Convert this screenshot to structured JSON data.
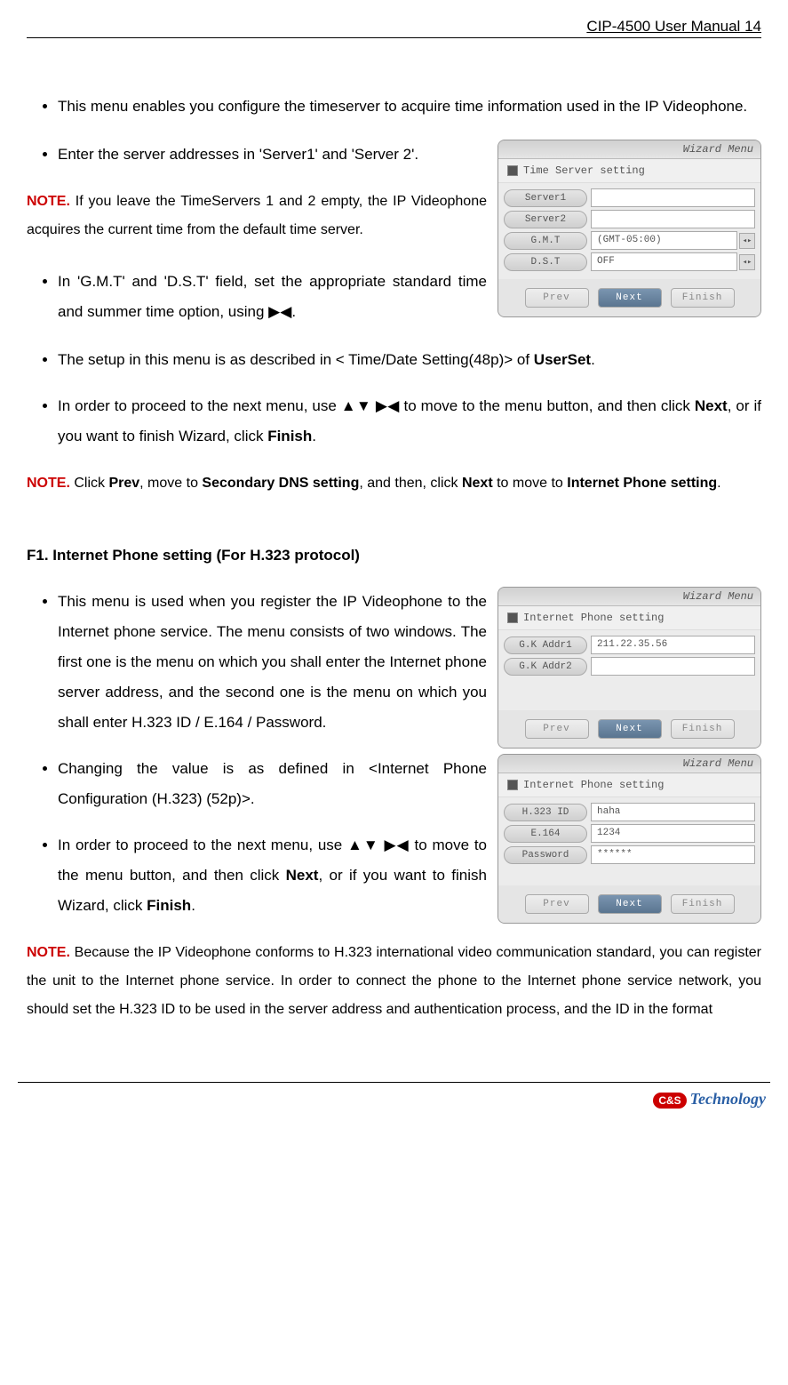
{
  "header": {
    "manual": "CIP-4500 User Manual",
    "page": "14"
  },
  "bullets1": [
    "This menu enables you configure the timeserver to acquire time information used in the IP Videophone.",
    "Enter the server addresses in 'Server1' and 'Server 2'."
  ],
  "note1": {
    "label": "NOTE.",
    "text": " If you leave the TimeServers 1 and 2 empty, the IP Videophone acquires the current time from the default time server."
  },
  "bullets2": [
    "In 'G.M.T' and 'D.S.T' field, set the appropriate standard time and summer time option, using ▶◀.",
    "The setup in this menu is as described in < Time/Date Setting(48p)> of ",
    "In order to proceed to the next menu, use ▲▼ ▶◀ to move to the menu button, and then click "
  ],
  "bullets2_bold": {
    "userset": "UserSet",
    "next": "Next",
    "finish": "Finish",
    "tail": ", or if you want to finish Wizard, click "
  },
  "note2": {
    "label": "NOTE.",
    "parts": {
      "p1": " Click ",
      "p2": "Prev",
      "p3": ", move to ",
      "p4": "Secondary DNS setting",
      "p5": ", and then, click ",
      "p6": "Next",
      "p7": " to move to ",
      "p8": "Internet Phone setting",
      "p9": "."
    }
  },
  "sectionF1": {
    "title": "F1. Internet Phone setting (For H.323 protocol)"
  },
  "bulletsF1": [
    "This menu is used when you register the IP Videophone to the Internet phone service. The menu consists of two windows. The first one is the menu on which you shall enter the Internet phone server address, and the second one is the menu on which you shall enter H.323 ID / E.164 / Password.",
    "Changing the value is as defined in <Internet Phone Configuration (H.323) (52p)>.",
    "In order to proceed to the next menu, use ▲▼ ▶◀ to move to the menu button, and then click "
  ],
  "bulletsF1_bold": {
    "next": "Next",
    "mid": ", or if you want to finish Wizard, click ",
    "finish": "Finish",
    "dot": "."
  },
  "note3": {
    "label": "NOTE.",
    "text": " Because the IP Videophone conforms to H.323 international video communication standard, you can register the unit to the Internet phone service. In order to connect the phone to the Internet phone service network, you should set the H.323 ID to be used in the server address and authentication process, and the ID in the format"
  },
  "screenshot_time": {
    "title": "Wizard Menu",
    "sub": "Time Server setting",
    "rows": {
      "server1": {
        "label": "Server1",
        "value": ""
      },
      "server2": {
        "label": "Server2",
        "value": ""
      },
      "gmt": {
        "label": "G.M.T",
        "value": "(GMT-05:00)"
      },
      "dst": {
        "label": "D.S.T",
        "value": "OFF"
      }
    },
    "buttons": {
      "prev": "Prev",
      "next": "Next",
      "finish": "Finish"
    }
  },
  "screenshot_gk": {
    "title": "Wizard Menu",
    "sub": "Internet Phone setting",
    "rows": {
      "gk1": {
        "label": "G.K Addr1",
        "value": "211.22.35.56"
      },
      "gk2": {
        "label": "G.K Addr2",
        "value": ""
      }
    },
    "buttons": {
      "prev": "Prev",
      "next": "Next",
      "finish": "Finish"
    }
  },
  "screenshot_h323": {
    "title": "Wizard Menu",
    "sub": "Internet Phone setting",
    "rows": {
      "hid": {
        "label": "H.323 ID",
        "value": "haha"
      },
      "e164": {
        "label": "E.164",
        "value": "1234"
      },
      "pw": {
        "label": "Password",
        "value": "******"
      }
    },
    "buttons": {
      "prev": "Prev",
      "next": "Next",
      "finish": "Finish"
    }
  },
  "logo": {
    "icon": "C&S",
    "text": "Technology"
  }
}
